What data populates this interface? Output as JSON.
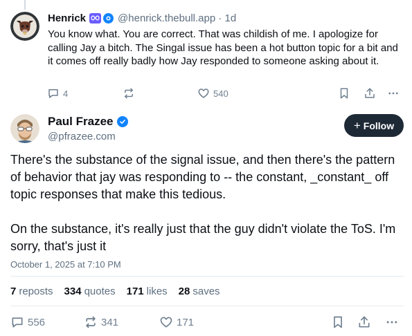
{
  "parent_post": {
    "author_name": "Henrick",
    "handle_time": "@henrick.thebull.app · 1d",
    "text": "You know what. You are correct. That was childish of me. I apologize for calling Jay a bitch. The Singal issue has been a hot button topic for a bit and it comes off really badly how Jay responded to someone asking about it.",
    "reply_count": "4",
    "repost_count": "",
    "like_count": "540",
    "badges": [
      "infinity-badge",
      "verified-badge"
    ]
  },
  "main_post": {
    "author_name": "Paul Frazee",
    "handle": "@pfrazee.com",
    "follow_label": "Follow",
    "text": "There's the substance of the signal issue, and then there's the pattern of behavior that jay was responding to -- the constant, _constant_ off topic responses that make this tedious.\n\nOn the substance, it's really just that the guy didn't violate the ToS. I'm sorry, that's just it",
    "date": "October 1, 2025 at 7:10 PM",
    "stats": {
      "reposts_count": "7",
      "reposts_label": "reposts",
      "quotes_count": "334",
      "quotes_label": "quotes",
      "likes_count": "171",
      "likes_label": "likes",
      "saves_count": "28",
      "saves_label": "saves"
    },
    "actions": {
      "reply_count": "556",
      "repost_count": "341",
      "like_count": "171"
    }
  },
  "colors": {
    "text": "#0b0f14",
    "muted": "#5e6f80",
    "icon": "#6f7f8f",
    "follow_bg": "#1e2936",
    "verified": "#1083fe",
    "badge_purple": "#6b5cff"
  }
}
